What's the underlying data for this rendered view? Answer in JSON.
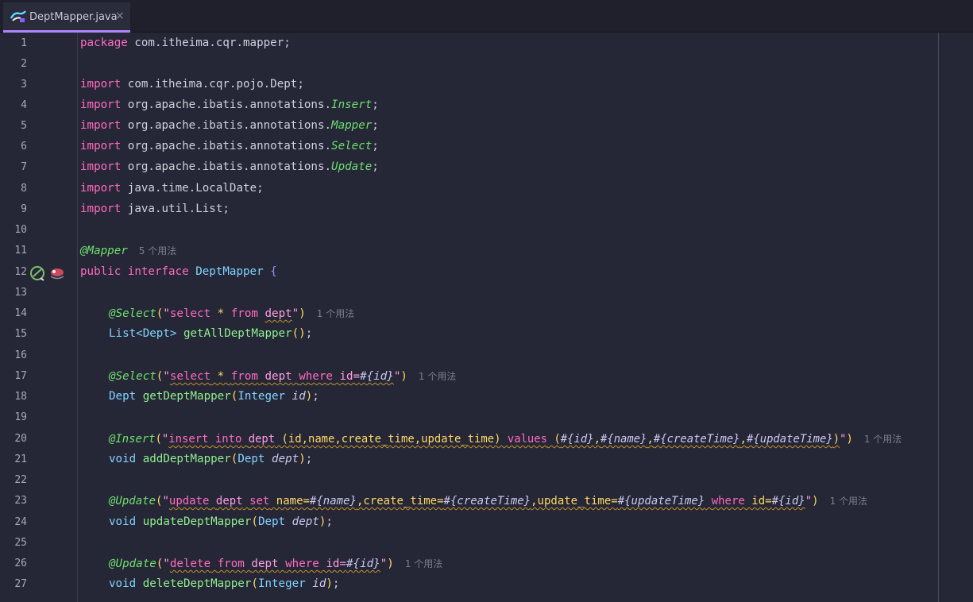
{
  "tab": {
    "title": "DeptMapper.java",
    "close": "×"
  },
  "lines": [
    "1",
    "2",
    "3",
    "4",
    "5",
    "6",
    "7",
    "8",
    "9",
    "10",
    "11",
    "12",
    "13",
    "14",
    "15",
    "16",
    "17",
    "18",
    "19",
    "20",
    "21",
    "22",
    "23",
    "24",
    "25",
    "26",
    "27"
  ],
  "code": {
    "l1": {
      "kw": "package",
      "rest": " com.itheima.cqr.mapper;"
    },
    "l3": {
      "kw": "import",
      "rest": " com.itheima.cqr.pojo.Dept;"
    },
    "l4": {
      "kw": "import",
      "rest": " org.apache.ibatis.annotations.",
      "cls": "Insert",
      "end": ";"
    },
    "l5": {
      "kw": "import",
      "rest": " org.apache.ibatis.annotations.",
      "cls": "Mapper",
      "end": ";"
    },
    "l6": {
      "kw": "import",
      "rest": " org.apache.ibatis.annotations.",
      "cls": "Select",
      "end": ";"
    },
    "l7": {
      "kw": "import",
      "rest": " org.apache.ibatis.annotations.",
      "cls": "Update",
      "end": ";"
    },
    "l8": {
      "kw": "import",
      "rest": " java.time.LocalDate;"
    },
    "l9": {
      "kw": "import",
      "rest": " java.util.List;"
    },
    "l11": {
      "ann": "@Mapper",
      "hint": "5 个用法"
    },
    "l12": {
      "kw1": "public",
      "kw2": "interface",
      "name": "DeptMapper",
      "brace": "{"
    },
    "l14": {
      "ann": "@Select",
      "open": "(",
      "q1": "\"",
      "s1": "select",
      "s2": " * ",
      "s3": "from",
      "s4": " ",
      "s5": "dept",
      "q2": "\"",
      "close": ")",
      "hint": "1 个用法"
    },
    "l15": {
      "t1": "List<Dept> ",
      "m": "getAllDeptMapper",
      "p": "()",
      "end": ";"
    },
    "l17": {
      "ann": "@Select",
      "open": "(",
      "q1": "\"",
      "s1": "select",
      "s2": " * ",
      "s3": "from",
      "s4": " ",
      "s5": "dept",
      "s6": " ",
      "s7": "where",
      "s8": " id=",
      "s9": "#{id}",
      "q2": "\"",
      "close": ")",
      "hint": "1 个用法"
    },
    "l18": {
      "t1": "Dept ",
      "m": "getDeptMapper",
      "po": "(",
      "pt": "Integer ",
      "pn": "id",
      "pc": ")",
      "end": ";"
    },
    "l20": {
      "ann": "@Insert",
      "open": "(",
      "q1": "\"",
      "s1": "insert",
      "s2": " ",
      "s3": "into",
      "s4": " ",
      "s5": "dept",
      "s6": " (id,name,create_time,update_time) ",
      "s7": "values",
      "s8": " (",
      "v1": "#{id}",
      "c1": ",",
      "v2": "#{name}",
      "c2": ",",
      "v3": "#{createTime}",
      "c3": ",",
      "v4": "#{updateTime}",
      "s9": ")",
      "q2": "\"",
      "close": ")",
      "hint": "1 个用法"
    },
    "l21": {
      "t1": "void ",
      "m": "addDeptMapper",
      "po": "(",
      "pt": "Dept ",
      "pn": "dept",
      "pc": ")",
      "end": ";"
    },
    "l23": {
      "ann": "@Update",
      "open": "(",
      "q1": "\"",
      "s1": "update",
      "s2": " ",
      "s3": "dept",
      "s4": " ",
      "s5": "set",
      "s6": " name=",
      "v1": "#{name}",
      "s7": ",create_time=",
      "v2": "#{createTime}",
      "s8": ",update_time=",
      "v3": "#{updateTime}",
      "s9": " ",
      "s10": "where",
      "s11": " id=",
      "v4": "#{id}",
      "q2": "\"",
      "close": ")",
      "hint": "1 个用法"
    },
    "l24": {
      "t1": "void ",
      "m": "updateDeptMapper",
      "po": "(",
      "pt": "Dept ",
      "pn": "dept",
      "pc": ")",
      "end": ";"
    },
    "l26": {
      "ann": "@Update",
      "open": "(",
      "q1": "\"",
      "s1": "delete",
      "s2": " ",
      "s3": "from",
      "s4": " ",
      "s5": "dept",
      "s6": " ",
      "s7": "where",
      "s8": " id=",
      "v1": "#{id}",
      "q2": "\"",
      "close": ")",
      "hint": "1 个用法"
    },
    "l27": {
      "t1": "void ",
      "m": "deleteDeptMapper",
      "po": "(",
      "pt": "Integer ",
      "pn": "id",
      "pc": ")",
      "end": ";"
    }
  },
  "icons": {
    "tab": "java-class-icon",
    "gutter_bean": "spring-bean-icon",
    "gutter_mapper": "mybatis-mapper-icon"
  },
  "colors": {
    "background": "#262736",
    "keyword": "#ff6ac1",
    "annotation": "#6ee06e",
    "type": "#7fd3ff",
    "method": "#8ef08e"
  }
}
